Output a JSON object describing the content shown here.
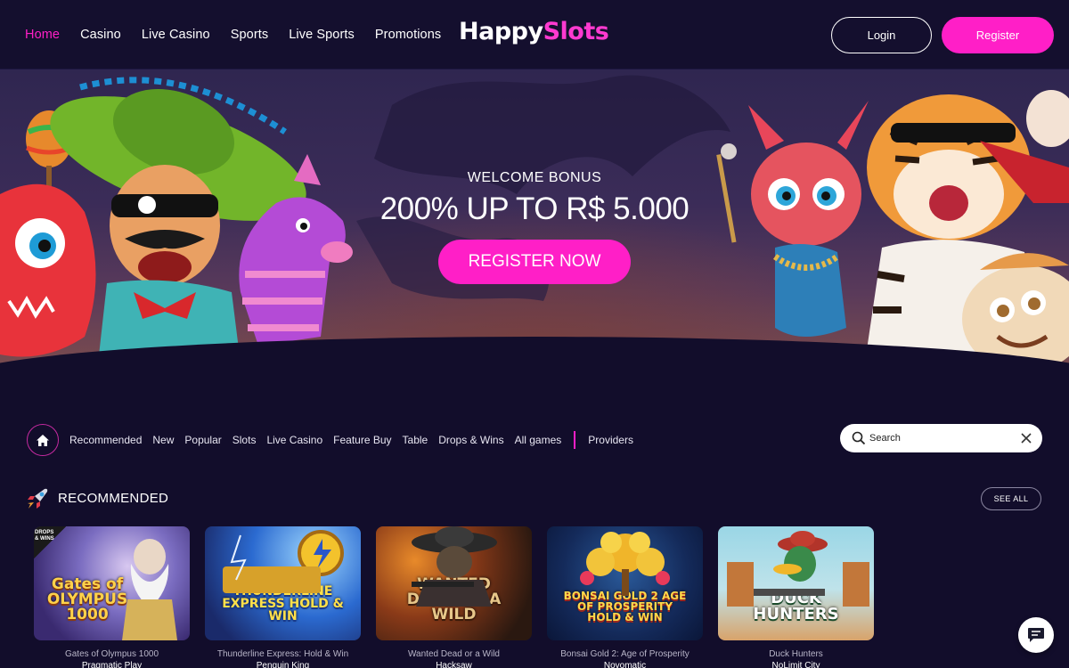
{
  "header": {
    "nav": [
      "Home",
      "Casino",
      "Live Casino",
      "Sports",
      "Live Sports",
      "Promotions"
    ],
    "logo_part1": "Happy",
    "logo_part2": "Slots",
    "login_label": "Login",
    "register_label": "Register"
  },
  "hero": {
    "welcome": "WELCOME BONUS",
    "bonus": "200% UP TO R$ 5.000",
    "cta_label": "REGISTER NOW"
  },
  "categories": [
    "Recommended",
    "New",
    "Popular",
    "Slots",
    "Live Casino",
    "Feature Buy",
    "Table",
    "Drops & Wins",
    "All games"
  ],
  "providers_label": "Providers",
  "search": {
    "placeholder": "Search"
  },
  "section": {
    "title": "RECOMMENDED",
    "see_all_label": "SEE ALL"
  },
  "games": [
    {
      "name": "Gates of Olympus 1000",
      "provider": "Pragmatic Play",
      "art_text": "Gates of OLYMPUS 1000",
      "badge": "DROPS & WINS"
    },
    {
      "name": "Thunderline Express: Hold & Win",
      "provider": "Penguin King",
      "art_text": "THUNDERLINE EXPRESS HOLD & WIN"
    },
    {
      "name": "Wanted Dead or a Wild",
      "provider": "Hacksaw",
      "art_text": "WANTED DEAD OR A WILD"
    },
    {
      "name": "Bonsai Gold 2: Age of Prosperity",
      "provider": "Novomatic",
      "art_text": "BONSAI GOLD 2 AGE OF PROSPERITY HOLD & WIN"
    },
    {
      "name": "Duck Hunters",
      "provider": "NoLimit City",
      "art_text": "DUCK HUNTERS"
    }
  ],
  "colors": {
    "accent": "#ff1fc7",
    "background": "#120d2b",
    "header": "#140f2e"
  }
}
